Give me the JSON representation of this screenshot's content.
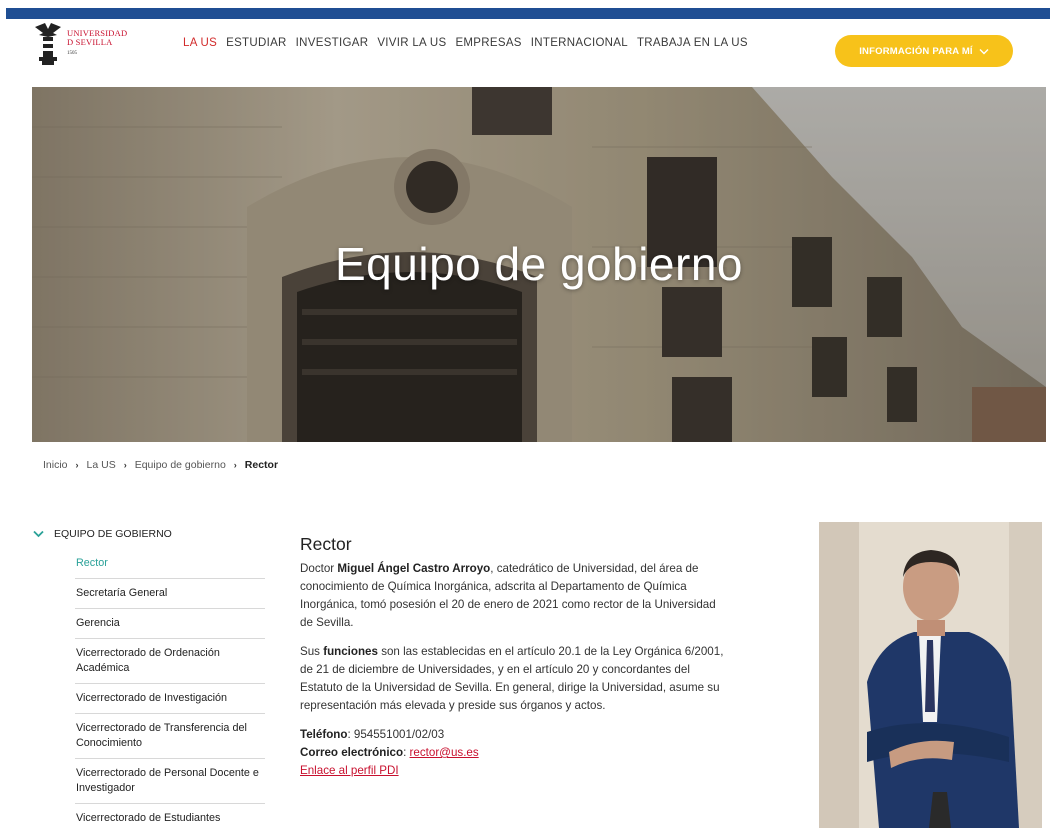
{
  "logo": {
    "line1": "UNIVERSIDAD",
    "line2": "D SEVILLA",
    "year": "1505"
  },
  "nav": {
    "items": [
      "LA US",
      "ESTUDIAR",
      "INVESTIGAR",
      "VIVIR LA US",
      "EMPRESAS",
      "INTERNACIONAL",
      "TRABAJA EN LA US"
    ],
    "active_index": 0
  },
  "info_button": {
    "label": "INFORMACIÓN PARA MÍ",
    "icon": "chevron-down-icon"
  },
  "hero": {
    "title": "Equipo de gobierno"
  },
  "breadcrumb": {
    "items": [
      "Inicio",
      "La US",
      "Equipo de gobierno"
    ],
    "current": "Rector"
  },
  "sidebar": {
    "heading": "EQUIPO DE GOBIERNO",
    "items": [
      "Rector",
      "Secretaría General",
      "Gerencia",
      "Vicerrectorado de Ordenación Académica",
      "Vicerrectorado de Investigación",
      "Vicerrectorado de Transferencia del Conocimiento",
      "Vicerrectorado de Personal Docente e Investigador",
      "Vicerrectorado de Estudiantes"
    ],
    "active_index": 0
  },
  "content": {
    "title": "Rector",
    "p1": {
      "prefix": "Doctor ",
      "name": "Miguel Ángel Castro Arroyo",
      "suffix": ", catedrático de Universidad, del área de conocimiento de Química Inorgánica, adscrita al Departamento de Química Inorgánica, tomó posesión el 20 de enero de 2021 como rector de la Universidad de Sevilla."
    },
    "p2": {
      "prefix": "Sus ",
      "bold": "funciones",
      "suffix": " son las establecidas en el artículo 20.1 de la Ley Orgánica 6/2001, de 21 de diciembre de Universidades, y en el artículo 20 y concordantes del Estatuto de la Universidad de Sevilla. En general, dirige la Universidad, asume su representación más elevada y preside sus órganos y actos."
    },
    "phone_label": "Teléfono",
    "phone_value": ": 954551001/02/03",
    "email_label": "Correo electrónico",
    "email_sep": ": ",
    "email_value": "rector@us.es",
    "profile_link": "Enlace al perfil PDI"
  },
  "colors": {
    "topbar": "#1f4e93",
    "accent_red": "#c8102e",
    "nav_active": "#d22b2b",
    "button_yellow": "#f7c21a",
    "sidebar_active": "#2aa198"
  }
}
